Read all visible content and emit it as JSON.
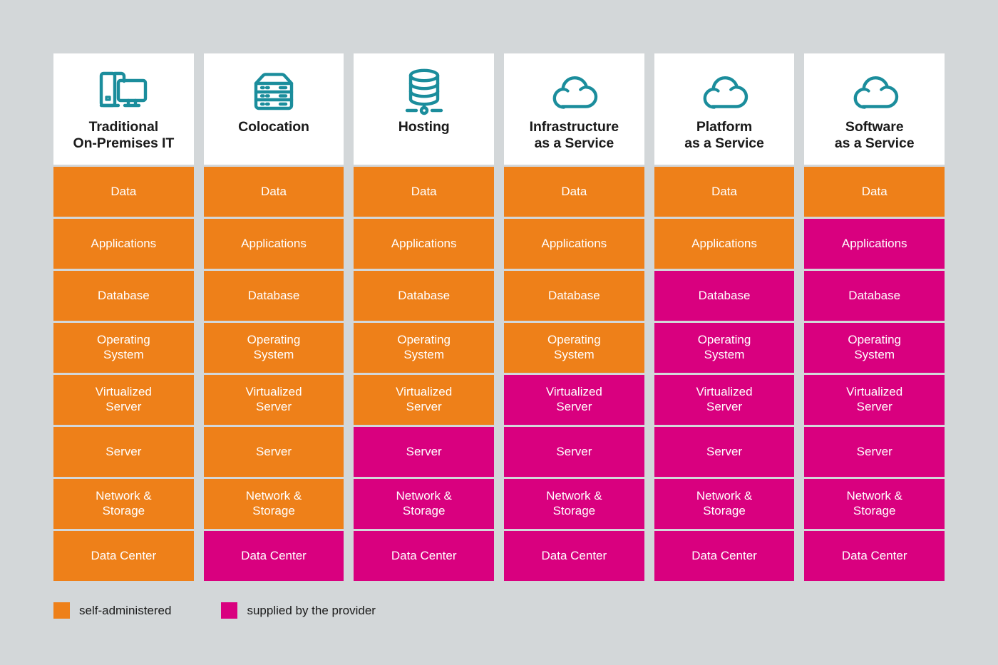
{
  "colors": {
    "self_administered": "#ee8019",
    "supplied_by_provider": "#d9007f",
    "icon_teal": "#1b8d9c",
    "background": "#d3d7d9",
    "card": "#ffffff",
    "text_dark": "#1b1b1b",
    "cell_text": "#ffffff"
  },
  "legend": {
    "items": [
      {
        "key": "self",
        "label": "self-administered",
        "color": "#ee8019"
      },
      {
        "key": "provider",
        "label": "supplied by the provider",
        "color": "#d9007f"
      }
    ]
  },
  "layers": [
    "Data",
    "Applications",
    "Database",
    "Operating\nSystem",
    "Virtualized\nServer",
    "Server",
    "Network &\nStorage",
    "Data Center"
  ],
  "columns": [
    {
      "id": "traditional-on-premises-it",
      "title": "Traditional\nOn-Premises IT",
      "icon": "desktop-computer-icon",
      "cells": [
        {
          "label": "Data",
          "owner": "self"
        },
        {
          "label": "Applications",
          "owner": "self"
        },
        {
          "label": "Database",
          "owner": "self"
        },
        {
          "label": "Operating\nSystem",
          "owner": "self"
        },
        {
          "label": "Virtualized\nServer",
          "owner": "self"
        },
        {
          "label": "Server",
          "owner": "self"
        },
        {
          "label": "Network &\nStorage",
          "owner": "self"
        },
        {
          "label": "Data Center",
          "owner": "self"
        }
      ]
    },
    {
      "id": "colocation",
      "title": "Colocation",
      "icon": "server-rack-icon",
      "cells": [
        {
          "label": "Data",
          "owner": "self"
        },
        {
          "label": "Applications",
          "owner": "self"
        },
        {
          "label": "Database",
          "owner": "self"
        },
        {
          "label": "Operating\nSystem",
          "owner": "self"
        },
        {
          "label": "Virtualized\nServer",
          "owner": "self"
        },
        {
          "label": "Server",
          "owner": "self"
        },
        {
          "label": "Network &\nStorage",
          "owner": "self"
        },
        {
          "label": "Data Center",
          "owner": "provider"
        }
      ]
    },
    {
      "id": "hosting",
      "title": "Hosting",
      "icon": "database-network-icon",
      "cells": [
        {
          "label": "Data",
          "owner": "self"
        },
        {
          "label": "Applications",
          "owner": "self"
        },
        {
          "label": "Database",
          "owner": "self"
        },
        {
          "label": "Operating\nSystem",
          "owner": "self"
        },
        {
          "label": "Virtualized\nServer",
          "owner": "self"
        },
        {
          "label": "Server",
          "owner": "provider"
        },
        {
          "label": "Network &\nStorage",
          "owner": "provider"
        },
        {
          "label": "Data Center",
          "owner": "provider"
        }
      ]
    },
    {
      "id": "infrastructure-as-a-service",
      "title": "Infrastructure\nas a Service",
      "icon": "cloud-icon",
      "cells": [
        {
          "label": "Data",
          "owner": "self"
        },
        {
          "label": "Applications",
          "owner": "self"
        },
        {
          "label": "Database",
          "owner": "self"
        },
        {
          "label": "Operating\nSystem",
          "owner": "self"
        },
        {
          "label": "Virtualized\nServer",
          "owner": "provider"
        },
        {
          "label": "Server",
          "owner": "provider"
        },
        {
          "label": "Network &\nStorage",
          "owner": "provider"
        },
        {
          "label": "Data Center",
          "owner": "provider"
        }
      ]
    },
    {
      "id": "platform-as-a-service",
      "title": "Platform\nas a Service",
      "icon": "cloud-icon",
      "cells": [
        {
          "label": "Data",
          "owner": "self"
        },
        {
          "label": "Applications",
          "owner": "self"
        },
        {
          "label": "Database",
          "owner": "provider"
        },
        {
          "label": "Operating\nSystem",
          "owner": "provider"
        },
        {
          "label": "Virtualized\nServer",
          "owner": "provider"
        },
        {
          "label": "Server",
          "owner": "provider"
        },
        {
          "label": "Network &\nStorage",
          "owner": "provider"
        },
        {
          "label": "Data Center",
          "owner": "provider"
        }
      ]
    },
    {
      "id": "software-as-a-service",
      "title": "Software\nas a Service",
      "icon": "cloud-icon",
      "cells": [
        {
          "label": "Data",
          "owner": "self"
        },
        {
          "label": "Applications",
          "owner": "provider"
        },
        {
          "label": "Database",
          "owner": "provider"
        },
        {
          "label": "Operating\nSystem",
          "owner": "provider"
        },
        {
          "label": "Virtualized\nServer",
          "owner": "provider"
        },
        {
          "label": "Server",
          "owner": "provider"
        },
        {
          "label": "Network &\nStorage",
          "owner": "provider"
        },
        {
          "label": "Data Center",
          "owner": "provider"
        }
      ]
    }
  ]
}
